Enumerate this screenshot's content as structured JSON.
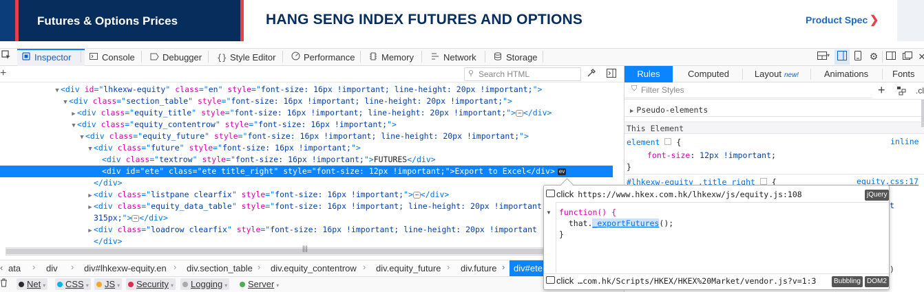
{
  "page_header": {
    "left_title": "Futures & Options Prices",
    "main_title": "HANG SENG INDEX FUTURES AND OPTIONS",
    "product_spec_link": "Product Spec",
    "chevron": "❯"
  },
  "devtools": {
    "tabs": [
      {
        "label": "Inspector",
        "icon": "inspector-icon"
      },
      {
        "label": "Console",
        "icon": "console-icon"
      },
      {
        "label": "Debugger",
        "icon": "debugger-icon"
      },
      {
        "label": "Style Editor",
        "icon": "style-editor-icon"
      },
      {
        "label": "Performance",
        "icon": "performance-icon"
      },
      {
        "label": "Memory",
        "icon": "memory-icon"
      },
      {
        "label": "Network",
        "icon": "network-icon"
      },
      {
        "label": "Storage",
        "icon": "storage-icon"
      }
    ],
    "accent_color": "#0a84ff"
  },
  "markup": {
    "search_placeholder": "Search HTML",
    "lines": [
      {
        "indent": 0,
        "twisty": "▼",
        "parts": [
          [
            "tag",
            "<div "
          ],
          [
            "an",
            "id"
          ],
          [
            "tag",
            "=\""
          ],
          [
            "av",
            "lhkexw-equity"
          ],
          [
            "tag",
            "\" "
          ],
          [
            "an",
            "class"
          ],
          [
            "tag",
            "=\""
          ],
          [
            "av",
            "en"
          ],
          [
            "tag",
            "\" "
          ],
          [
            "an",
            "style"
          ],
          [
            "tag",
            "=\""
          ],
          [
            "av",
            "font-size: 16px !important; line-height: 20px !important;"
          ],
          [
            "tag",
            "\">"
          ]
        ]
      },
      {
        "indent": 1,
        "twisty": "▼",
        "parts": [
          [
            "tag",
            "<div "
          ],
          [
            "an",
            "class"
          ],
          [
            "tag",
            "=\""
          ],
          [
            "av",
            "section_table"
          ],
          [
            "tag",
            "\" "
          ],
          [
            "an",
            "style"
          ],
          [
            "tag",
            "=\""
          ],
          [
            "av",
            "font-size: 16px !important; line-height: 20px !important;"
          ],
          [
            "tag",
            "\">"
          ]
        ]
      },
      {
        "indent": 2,
        "twisty": "▶",
        "parts": [
          [
            "tag",
            "<div "
          ],
          [
            "an",
            "class"
          ],
          [
            "tag",
            "=\""
          ],
          [
            "av",
            "equity_title"
          ],
          [
            "tag",
            "\" "
          ],
          [
            "an",
            "style"
          ],
          [
            "tag",
            "=\""
          ],
          [
            "av",
            "font-size: 16px !important; line-height: 20px !important;"
          ],
          [
            "tag",
            "\">"
          ],
          [
            "dots",
            "⋯"
          ],
          [
            "tag",
            "</div>"
          ]
        ]
      },
      {
        "indent": 2,
        "twisty": "▼",
        "parts": [
          [
            "tag",
            "<div "
          ],
          [
            "an",
            "class"
          ],
          [
            "tag",
            "=\""
          ],
          [
            "av",
            "equity_contentrow"
          ],
          [
            "tag",
            "\" "
          ],
          [
            "an",
            "style"
          ],
          [
            "tag",
            "=\""
          ],
          [
            "av",
            "font-size: 16px !important;"
          ],
          [
            "tag",
            "\">"
          ]
        ]
      },
      {
        "indent": 3,
        "twisty": "▼",
        "parts": [
          [
            "tag",
            "<div "
          ],
          [
            "an",
            "class"
          ],
          [
            "tag",
            "=\""
          ],
          [
            "av",
            "equity_future"
          ],
          [
            "tag",
            "\" "
          ],
          [
            "an",
            "style"
          ],
          [
            "tag",
            "=\""
          ],
          [
            "av",
            "font-size: 16px !important; line-height: 20px !important;"
          ],
          [
            "tag",
            "\">"
          ]
        ]
      },
      {
        "indent": 4,
        "twisty": "▼",
        "parts": [
          [
            "tag",
            "<div "
          ],
          [
            "an",
            "class"
          ],
          [
            "tag",
            "=\""
          ],
          [
            "av",
            "future"
          ],
          [
            "tag",
            "\" "
          ],
          [
            "an",
            "style"
          ],
          [
            "tag",
            "=\""
          ],
          [
            "av",
            "font-size: 16px !important;"
          ],
          [
            "tag",
            "\">"
          ]
        ]
      },
      {
        "indent": 5,
        "twisty": "",
        "parts": [
          [
            "tag",
            "<div "
          ],
          [
            "an",
            "class"
          ],
          [
            "tag",
            "=\""
          ],
          [
            "av",
            "textrow"
          ],
          [
            "tag",
            "\" "
          ],
          [
            "an",
            "style"
          ],
          [
            "tag",
            "=\""
          ],
          [
            "av",
            "font-size: 16px !important;"
          ],
          [
            "tag",
            "\">"
          ],
          [
            "txt",
            "FUTURES"
          ],
          [
            "tag",
            "</div>"
          ]
        ]
      },
      {
        "indent": 5,
        "twisty": "",
        "selected": true,
        "parts": [
          [
            "tag",
            "<div "
          ],
          [
            "an",
            "id"
          ],
          [
            "tag",
            "=\""
          ],
          [
            "av",
            "ete"
          ],
          [
            "tag",
            "\" "
          ],
          [
            "an",
            "class"
          ],
          [
            "tag",
            "=\""
          ],
          [
            "av",
            "ete title_right"
          ],
          [
            "tag",
            "\" "
          ],
          [
            "an",
            "style"
          ],
          [
            "tag",
            "=\""
          ],
          [
            "av",
            "font-size: 12px !important;"
          ],
          [
            "tag",
            "\">"
          ],
          [
            "txt",
            "Export to Excel"
          ],
          [
            "tag",
            "</div>"
          ],
          [
            "ev",
            "ev"
          ]
        ]
      },
      {
        "indent": 4,
        "twisty": "",
        "parts": [
          [
            "tag",
            "</div>"
          ]
        ]
      },
      {
        "indent": 4,
        "twisty": "▶",
        "parts": [
          [
            "tag",
            "<div "
          ],
          [
            "an",
            "class"
          ],
          [
            "tag",
            "=\""
          ],
          [
            "av",
            "listpane clearfix"
          ],
          [
            "tag",
            "\" "
          ],
          [
            "an",
            "style"
          ],
          [
            "tag",
            "=\""
          ],
          [
            "av",
            "font-size: 16px !important;"
          ],
          [
            "tag",
            "\">"
          ],
          [
            "dots",
            "⋯"
          ],
          [
            "tag",
            "</div>"
          ]
        ]
      },
      {
        "indent": 4,
        "twisty": "▶",
        "parts": [
          [
            "tag",
            "<div "
          ],
          [
            "an",
            "class"
          ],
          [
            "tag",
            "=\""
          ],
          [
            "av",
            "equity_data_table"
          ],
          [
            "tag",
            "\" "
          ],
          [
            "an",
            "style"
          ],
          [
            "tag",
            "=\""
          ],
          [
            "av",
            "font-size: 16px !important; line-height: 20px !important"
          ]
        ]
      },
      {
        "indent": 4,
        "twisty": "",
        "parts": [
          [
            "av",
            "315px;"
          ],
          [
            "tag",
            "\">"
          ],
          [
            "dots",
            "⋯"
          ],
          [
            "tag",
            "</div>"
          ]
        ]
      },
      {
        "indent": 4,
        "twisty": "▶",
        "parts": [
          [
            "tag",
            "<div "
          ],
          [
            "an",
            "class"
          ],
          [
            "tag",
            "=\""
          ],
          [
            "av",
            "loadrow clearfix"
          ],
          [
            "tag",
            "\" "
          ],
          [
            "an",
            "style"
          ],
          [
            "tag",
            "=\""
          ],
          [
            "av",
            "font-size: 16px !important; line-height: 20px !important"
          ]
        ]
      },
      {
        "indent": 4,
        "twisty": "",
        "parts": [
          [
            "tag",
            "</div>"
          ]
        ]
      }
    ]
  },
  "breadcrumbs": [
    "ata",
    "div",
    "div#lhkexw-equity.en",
    "div.section_table",
    "div.equity_contentrow",
    "div.equity_future",
    "div.future",
    "div#ete"
  ],
  "console_filters": [
    {
      "label": "Net",
      "color": "#2a2a2e"
    },
    {
      "label": "CSS",
      "color": "#0ab0e8"
    },
    {
      "label": "JS",
      "color": "#f5a623"
    },
    {
      "label": "Security",
      "color": "#e22850"
    },
    {
      "label": "Logging",
      "color": "#aaaaaa"
    },
    {
      "label": "Server",
      "color": "#4caf50"
    }
  ],
  "sidebar": {
    "tabs": [
      {
        "label": "Rules"
      },
      {
        "label": "Computed"
      },
      {
        "label": "Layout",
        "badge": "new!"
      },
      {
        "label": "Animations"
      },
      {
        "label": "Fonts"
      }
    ],
    "filter_placeholder": "Filter Styles",
    "cls_label": ".cl",
    "pseudo_elements": "Pseudo-elements",
    "this_element": "This Element",
    "element_rule": {
      "selector": "element",
      "source": "inline",
      "prop": "font-size",
      "value": "12px !important"
    },
    "second_rule": {
      "selector": "#lhkexw-equity .title_right",
      "source": "equity.css:17"
    }
  },
  "event_tooltip": {
    "events": [
      {
        "type": "click",
        "source": "https://www.hkex.com.hk/lhkexw/js/equity.js:108",
        "tags": [
          "jQuery"
        ]
      },
      {
        "type": "click",
        "source": "…com.hk/Scripts/HKEX/HKEX%20Market/vendor.js?v=1:3",
        "tags": [
          "Bubbling",
          "DOM2"
        ]
      }
    ],
    "code": {
      "line1": "function() {",
      "line2_prefix": "  that.",
      "line2_fn": "_exportFutures",
      "line2_suffix": "();",
      "line3": "}"
    },
    "peek_right_1": "t",
    "peek_right_2": ")"
  }
}
